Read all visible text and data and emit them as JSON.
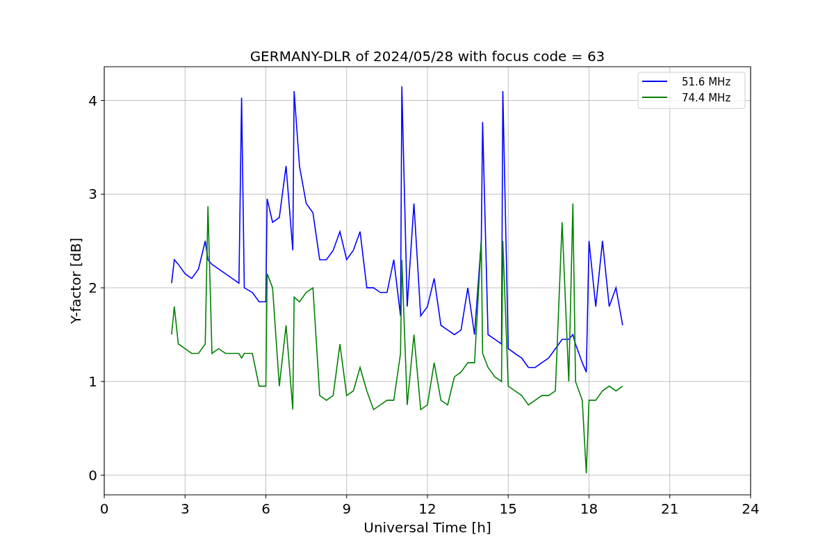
{
  "chart_data": {
    "type": "line",
    "title": "GERMANY-DLR of 2024/05/28 with focus code = 63",
    "xlabel": "Universal Time [h]",
    "ylabel": "Y-factor [dB]",
    "x": [
      2.5,
      2.6,
      2.75,
      3.0,
      3.25,
      3.5,
      3.75,
      3.85,
      4.0,
      4.25,
      4.5,
      4.75,
      5.0,
      5.1,
      5.2,
      5.5,
      5.75,
      6.0,
      6.05,
      6.25,
      6.5,
      6.75,
      7.0,
      7.05,
      7.25,
      7.5,
      7.75,
      8.0,
      8.25,
      8.5,
      8.75,
      9.0,
      9.25,
      9.5,
      9.75,
      10.0,
      10.25,
      10.5,
      10.75,
      11.0,
      11.05,
      11.25,
      11.5,
      11.75,
      12.0,
      12.25,
      12.5,
      12.75,
      13.0,
      13.25,
      13.5,
      13.75,
      14.0,
      14.05,
      14.25,
      14.5,
      14.75,
      14.8,
      15.0,
      15.25,
      15.5,
      15.75,
      16.0,
      16.25,
      16.5,
      16.75,
      17.0,
      17.25,
      17.4,
      17.5,
      17.75,
      17.9,
      18.0,
      18.25,
      18.5,
      18.75,
      19.0,
      19.25
    ],
    "series": [
      {
        "name": "51.6 MHz",
        "color": "#0000ff",
        "values": [
          2.05,
          2.3,
          2.25,
          2.15,
          2.1,
          2.2,
          2.5,
          2.3,
          2.25,
          2.2,
          2.15,
          2.1,
          2.05,
          4.03,
          2.0,
          1.95,
          1.85,
          1.85,
          2.95,
          2.7,
          2.75,
          3.3,
          2.4,
          4.1,
          3.3,
          2.9,
          2.8,
          2.3,
          2.3,
          2.4,
          2.6,
          2.3,
          2.4,
          2.6,
          2.0,
          2.0,
          1.95,
          1.95,
          2.3,
          1.7,
          4.15,
          1.8,
          2.9,
          1.7,
          1.8,
          2.1,
          1.6,
          1.55,
          1.5,
          1.55,
          2.0,
          1.5,
          2.5,
          3.77,
          1.5,
          1.45,
          1.4,
          4.1,
          1.35,
          1.3,
          1.25,
          1.15,
          1.15,
          1.2,
          1.25,
          1.35,
          1.45,
          1.45,
          1.5,
          1.4,
          1.2,
          1.1,
          2.5,
          1.8,
          2.5,
          1.8,
          2.0,
          1.6
        ]
      },
      {
        "name": "74.4 MHz",
        "color": "#008000",
        "values": [
          1.5,
          1.8,
          1.4,
          1.35,
          1.3,
          1.3,
          1.4,
          2.87,
          1.3,
          1.35,
          1.3,
          1.3,
          1.3,
          1.25,
          1.3,
          1.3,
          0.95,
          0.95,
          2.15,
          2.0,
          0.95,
          1.6,
          0.7,
          1.9,
          1.85,
          1.95,
          2.0,
          0.85,
          0.8,
          0.85,
          1.4,
          0.85,
          0.9,
          1.15,
          0.9,
          0.7,
          0.75,
          0.8,
          0.8,
          1.3,
          2.3,
          0.75,
          1.5,
          0.7,
          0.75,
          1.2,
          0.8,
          0.75,
          1.05,
          1.1,
          1.2,
          1.2,
          2.5,
          1.3,
          1.15,
          1.05,
          1.0,
          2.5,
          0.95,
          0.9,
          0.85,
          0.75,
          0.8,
          0.85,
          0.85,
          0.9,
          2.7,
          1.0,
          2.9,
          1.0,
          0.8,
          0.02,
          0.8,
          0.8,
          0.9,
          0.95,
          0.9,
          0.95
        ]
      }
    ],
    "grid": true,
    "legend": true,
    "xlim": [
      0,
      24
    ],
    "ylim": [
      -0.21,
      4.36
    ],
    "xticks": [
      0,
      3,
      6,
      9,
      12,
      15,
      18,
      21,
      24
    ],
    "yticks": [
      0,
      1,
      2,
      3,
      4
    ]
  }
}
